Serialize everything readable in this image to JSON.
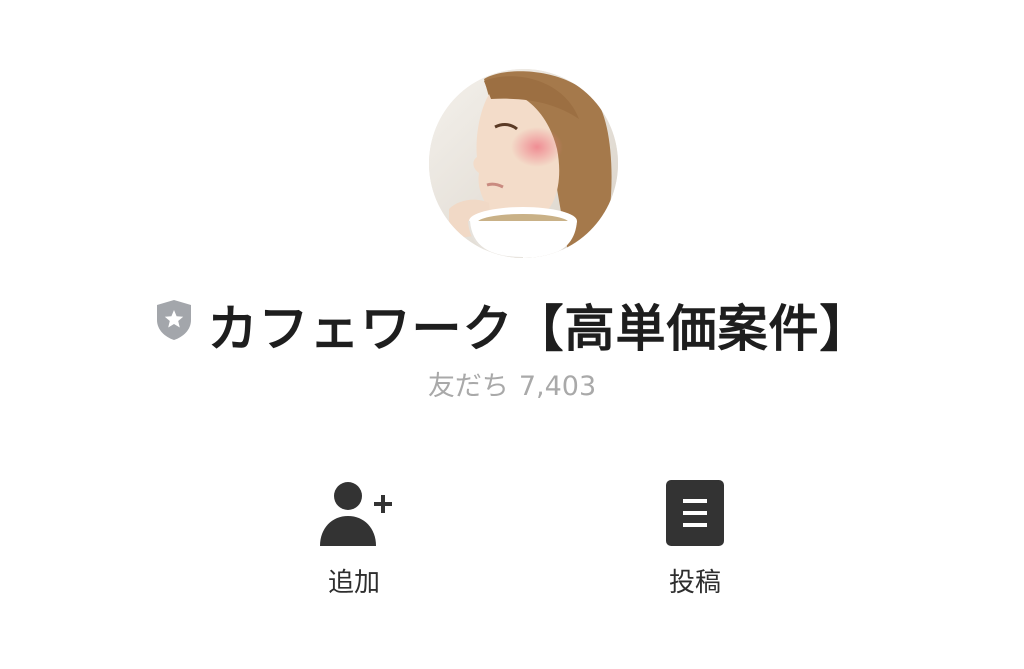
{
  "profile": {
    "name": "カフェワーク【高単価案件】",
    "friends_label": "友だち",
    "friends_count": "7,403"
  },
  "actions": [
    {
      "label": "追加",
      "icon": "add-friend-icon"
    },
    {
      "label": "投稿",
      "icon": "post-icon"
    }
  ],
  "colors": {
    "name_text": "#1e1e1e",
    "muted_text": "#a9a9a9",
    "icon_dark": "#333333",
    "badge_gray": "#a3a6ab"
  }
}
